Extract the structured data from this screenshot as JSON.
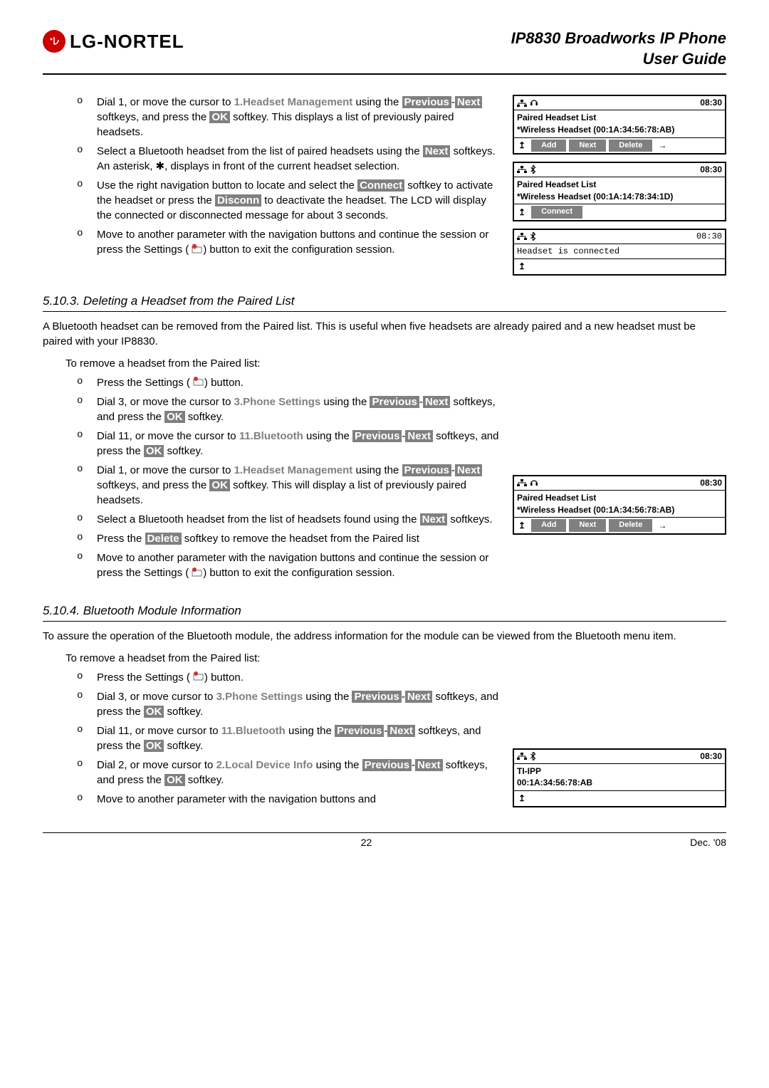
{
  "header": {
    "logo_text": "LG-NORTEL",
    "title_line1": "IP8830 Broadworks IP Phone",
    "title_line2": "User Guide"
  },
  "softkeys": {
    "previous": "Previous",
    "next": "Next",
    "ok": "OK",
    "connect": "Connect",
    "disconn": "Disconn",
    "delete": "Delete",
    "add": "Add",
    "next_btn": "Next"
  },
  "greylabels": {
    "headset_mgmt": "1.Headset Management",
    "phone_settings": "3.Phone Settings",
    "bluetooth": "11.Bluetooth",
    "local_device": "2.Local Device Info"
  },
  "section1_bullets": {
    "b1_a": "Dial 1, or move the cursor to ",
    "b1_b": " using the ",
    "b1_c": " softkeys, and press the ",
    "b1_d": " softkey.  This displays a list of previously paired headsets.",
    "b2_a": "Select a Bluetooth headset from the list of paired headsets using the ",
    "b2_b": " softkeys.  An asterisk, ",
    "b2_star": "✱",
    "b2_c": ", displays in front of the current headset selection.",
    "b3_a": "Use the right navigation button to locate and select the ",
    "b3_b": " softkey to activate the headset or press the ",
    "b3_c": " to deactivate the headset.  The LCD will display the connected or disconnected message for about 3 seconds.",
    "b4_a": "Move to another parameter with the navigation buttons and continue the session or press the Settings (",
    "b4_b": ") button to exit the configuration session."
  },
  "section_5_10_3": {
    "heading": "5.10.3. Deleting a Headset from the Paired List",
    "para": "A Bluetooth headset can be removed from the Paired list.  This is useful when five headsets are already paired and a new headset must be paired with your IP8830.",
    "lead": "To remove a headset from the Paired list:",
    "b1_a": "Press the Settings (",
    "b1_b": ") button.",
    "b2_a": "Dial 3, or move the cursor to ",
    "b2_b": " using the ",
    "b2_c": " softkeys, and press the ",
    "b2_d": " softkey.",
    "b3_a": "Dial 11, or move the cursor to ",
    "b3_b": " using the ",
    "b3_c": " softkeys, and press the ",
    "b3_d": " softkey.",
    "b4_a": "Dial 1, or move the cursor to ",
    "b4_b": " using the ",
    "b4_c": " softkeys, and press the ",
    "b4_d": " softkey.  This will display a list of previously paired headsets.",
    "b5_a": "Select a Bluetooth headset from the list of headsets found using the ",
    "b5_b": " softkeys.",
    "b6_a": "Press the ",
    "b6_b": " softkey to remove the headset from the Paired list",
    "b7_a": "Move to another parameter with the navigation buttons and continue the session or press the Settings (",
    "b7_b": ") button to exit the configuration session."
  },
  "section_5_10_4": {
    "heading": "5.10.4. Bluetooth Module Information",
    "para": "To assure the operation of the Bluetooth module, the address information for the module can be viewed from the Bluetooth menu item.",
    "lead": "To remove a headset from the Paired list:",
    "b1_a": "Press the Settings (",
    "b1_b": ") button.",
    "b2_a": "Dial 3, or move cursor to ",
    "b2_b": " using the ",
    "b2_c": " softkeys, and press the ",
    "b2_d": " softkey.",
    "b3_a": "Dial 11, or move cursor to ",
    "b3_b": " using the ",
    "b3_c": " softkeys, and press the ",
    "b3_d": " softkey.",
    "b4_a": "Dial 2, or move cursor to ",
    "b4_b": " using the ",
    "b4_c": " softkeys, and press the ",
    "b4_d": " softkey.",
    "b5": "Move to another parameter with the navigation buttons and"
  },
  "screens": {
    "time": "08:30",
    "paired_title": "Paired Headset List",
    "mac1": "*Wireless Headset (00:1A:34:56:78:AB)",
    "mac2": "*Wireless Headset (00:1A:14:78:34:1D)",
    "connected": "Headset is connected",
    "connect_label": "Connect",
    "add": "Add",
    "next": "Next",
    "delete": "Delete",
    "tiipp": "TI-IPP",
    "tiipp_mac": "00:1A:34:56:78:AB",
    "up": "⬆",
    "right": "→"
  },
  "footer": {
    "page": "22",
    "date": "Dec. '08"
  }
}
